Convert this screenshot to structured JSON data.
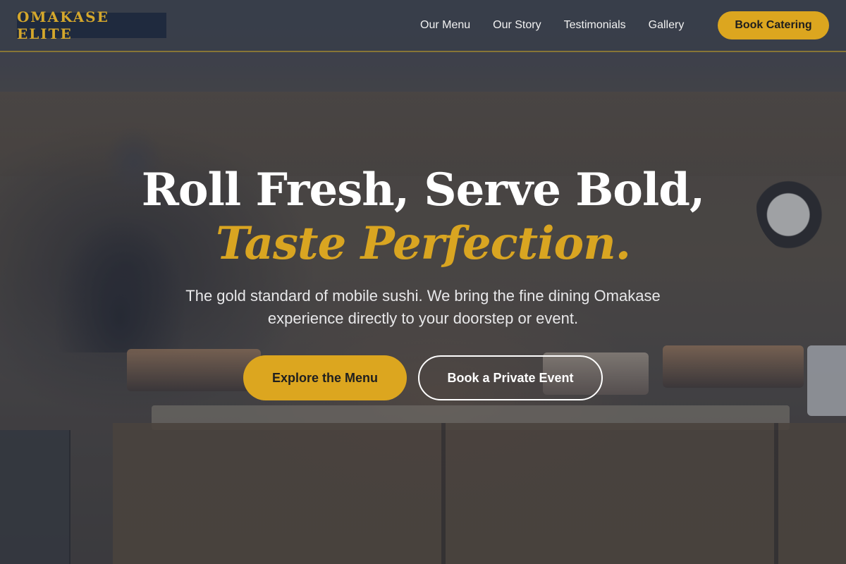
{
  "brand": {
    "logo_text": "OMAKASE ELITE"
  },
  "nav": {
    "items": [
      {
        "label": "Our Menu"
      },
      {
        "label": "Our Story"
      },
      {
        "label": "Testimonials"
      },
      {
        "label": "Gallery"
      }
    ],
    "cta_label": "Book Catering"
  },
  "hero": {
    "title_line1": "Roll Fresh, Serve Bold,",
    "title_line2": "Taste Perfection.",
    "subtitle": "The gold standard of mobile sushi. We bring the fine dining Omakase experience directly to your doorstep or event.",
    "primary_button": "Explore the Menu",
    "secondary_button": "Book a Private Event"
  },
  "colors": {
    "accent": "#dca61f",
    "logo_bg": "#1f2a3e",
    "text_light": "#ffffff"
  }
}
